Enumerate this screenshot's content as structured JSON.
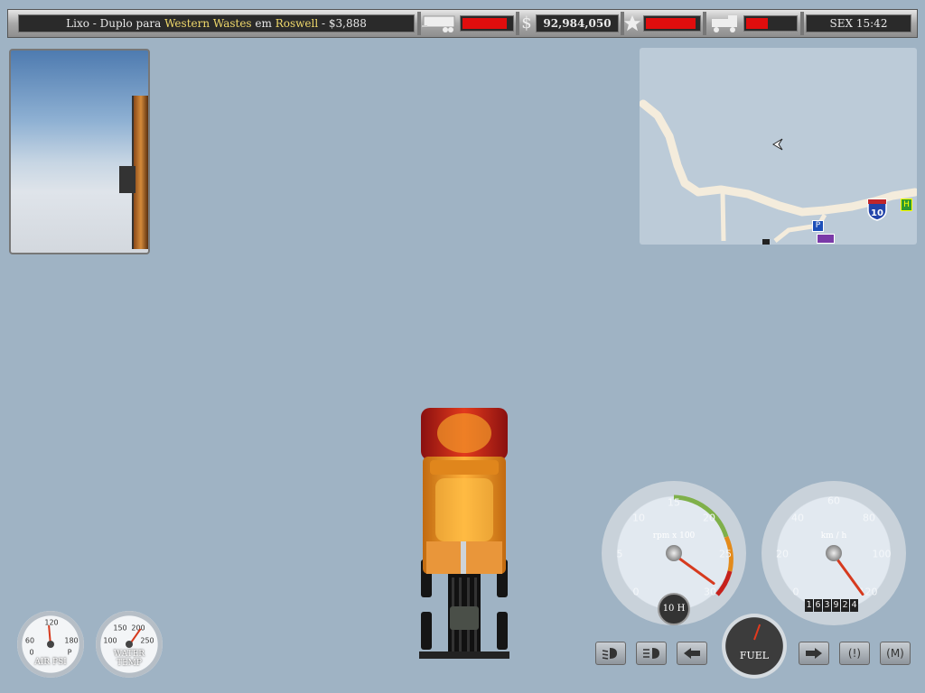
{
  "hud": {
    "job": {
      "cargo_prefix": "Lixo - Duplo para ",
      "company": "Western Wastes",
      "mid": " em ",
      "city": "Roswell",
      "reward": " - $3,888"
    },
    "money_symbol": "$",
    "money": "92,984,050",
    "clock": "SEX 15:42",
    "trailer_damage_level": 0.9,
    "reputation_level": 0.95,
    "truck_damage_level": 0.45,
    "icons": {
      "trailer": "trailer-icon",
      "money": "dollar-icon",
      "reputation": "star-icon",
      "truck": "truck-icon"
    },
    "colors": {
      "bar_fill": "#e00d0d",
      "highlight": "#f0d96b"
    }
  },
  "minimap": {
    "highway_shield": "10",
    "parking_sign": "P",
    "hotel_sign": "H",
    "cursor_icon": "cursor-arrow-icon"
  },
  "gauges": {
    "tachometer": {
      "ticks": [
        "0",
        "5",
        "10",
        "15",
        "20",
        "25",
        "30"
      ],
      "unit_label": "rpm x 100",
      "gear": "10 H",
      "needle_value": 29
    },
    "speedometer": {
      "ticks": [
        "0",
        "20",
        "40",
        "60",
        "80",
        "100",
        "120"
      ],
      "unit_label": "km / h",
      "needle_value": 124,
      "odometer": [
        "1",
        "6",
        "3",
        "9",
        "2",
        "4"
      ]
    },
    "air_psi": {
      "ticks": [
        "0",
        "60",
        "120",
        "180",
        "P"
      ],
      "title": "AIR PSI"
    },
    "water_temp": {
      "ticks": [
        "100",
        "150",
        "200",
        "250"
      ],
      "title_line1": "WATER",
      "title_line2": "TEMP"
    },
    "fuel": {
      "title": "FUEL"
    }
  },
  "indicators": {
    "left": [
      {
        "name": "low-beam-icon"
      },
      {
        "name": "high-beam-icon"
      },
      {
        "name": "left-turn-icon"
      }
    ],
    "right": [
      {
        "name": "right-turn-icon"
      },
      {
        "name": "hazard-icon",
        "text": "(!)"
      },
      {
        "name": "map-toggle-icon",
        "text": "(M)"
      }
    ]
  }
}
